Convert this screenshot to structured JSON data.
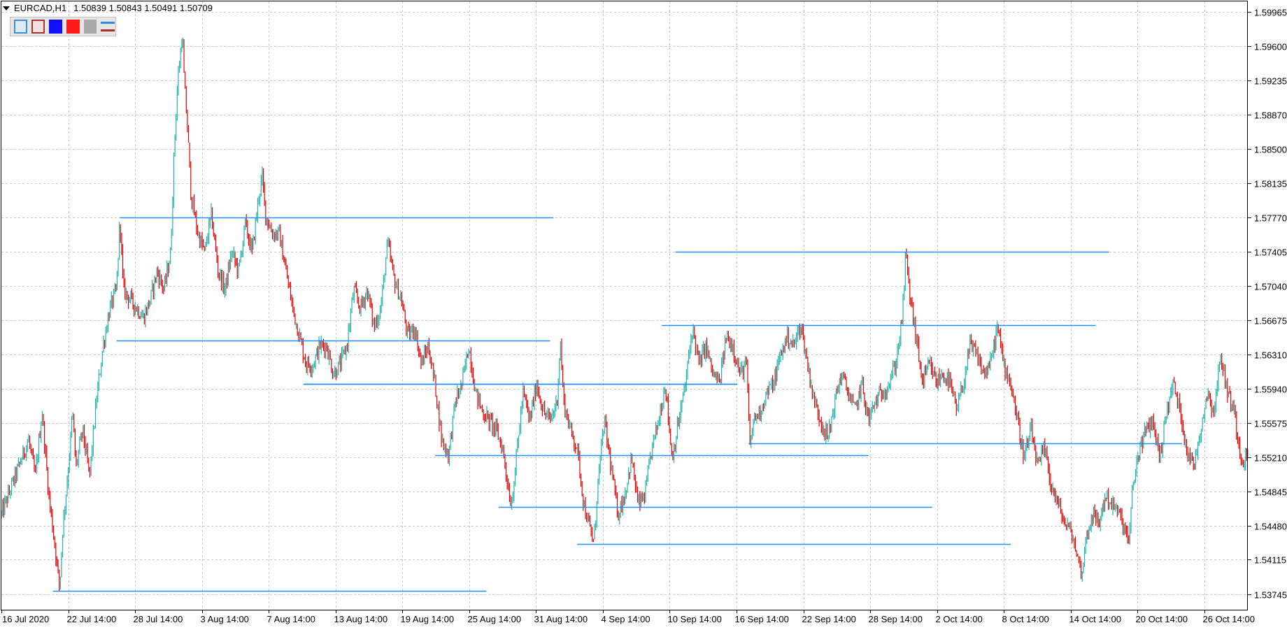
{
  "header": {
    "symbol": "EURCAD,H1",
    "ohlc": "1.50839 1.50843 1.50491 1.50709"
  },
  "toolbar": {
    "buttons": [
      "line-up-icon",
      "line-down-icon",
      "blue-color-icon",
      "red-color-icon",
      "gray-color-icon",
      "levels-icon"
    ]
  },
  "colors": {
    "background": "#ffffff",
    "grid": "#c8c8c8",
    "bull": "#20b2aa",
    "bear": "#e00000",
    "level": "#1e90ff"
  },
  "chart_data": {
    "type": "candlestick",
    "symbol": "EURCAD",
    "timeframe": "H1",
    "grid": true,
    "x_tick_labels": [
      "16 Jul 2020",
      "22 Jul 14:00",
      "28 Jul 14:00",
      "3 Aug 14:00",
      "7 Aug 14:00",
      "13 Aug 14:00",
      "19 Aug 14:00",
      "25 Aug 14:00",
      "31 Aug 14:00",
      "4 Sep 14:00",
      "10 Sep 14:00",
      "16 Sep 14:00",
      "22 Sep 14:00",
      "28 Sep 14:00",
      "2 Oct 14:00",
      "8 Oct 14:00",
      "14 Oct 14:00",
      "20 Oct 14:00",
      "26 Oct 14:00"
    ],
    "y_tick_labels": [
      "1.59965",
      "1.59600",
      "1.59235",
      "1.58870",
      "1.58500",
      "1.58135",
      "1.57770",
      "1.57405",
      "1.57040",
      "1.56675",
      "1.56310",
      "1.55940",
      "1.55575",
      "1.55210",
      "1.54845",
      "1.54480",
      "1.54115",
      "1.53745"
    ],
    "ylim": [
      1.5358,
      1.6008
    ],
    "price_path": [
      [
        0,
        1.546
      ],
      [
        2,
        1.55
      ],
      [
        4,
        1.554
      ],
      [
        5,
        1.55
      ],
      [
        6,
        1.557
      ],
      [
        7,
        1.548
      ],
      [
        8,
        1.542
      ],
      [
        8.6,
        1.538
      ],
      [
        9,
        1.544
      ],
      [
        10,
        1.552
      ],
      [
        10.5,
        1.557
      ],
      [
        11,
        1.551
      ],
      [
        12,
        1.555
      ],
      [
        13,
        1.55
      ],
      [
        14,
        1.558
      ],
      [
        15,
        1.564
      ],
      [
        16,
        1.568
      ],
      [
        17,
        1.57
      ],
      [
        17.5,
        1.5777
      ],
      [
        18,
        1.57
      ],
      [
        19,
        1.569
      ],
      [
        20,
        1.568
      ],
      [
        21,
        1.567
      ],
      [
        22,
        1.569
      ],
      [
        23,
        1.572
      ],
      [
        24,
        1.57
      ],
      [
        25,
        1.574
      ],
      [
        25.5,
        1.585
      ],
      [
        26,
        1.592
      ],
      [
        26.7,
        1.5975
      ],
      [
        27,
        1.592
      ],
      [
        27.5,
        1.587
      ],
      [
        28,
        1.58
      ],
      [
        29,
        1.576
      ],
      [
        30,
        1.574
      ],
      [
        31,
        1.578
      ],
      [
        32,
        1.572
      ],
      [
        33,
        1.57
      ],
      [
        34,
        1.574
      ],
      [
        35,
        1.572
      ],
      [
        36,
        1.577
      ],
      [
        37,
        1.574
      ],
      [
        38,
        1.58
      ],
      [
        38.5,
        1.582
      ],
      [
        39,
        1.578
      ],
      [
        40,
        1.576
      ],
      [
        41,
        1.576
      ],
      [
        42,
        1.572
      ],
      [
        43,
        1.568
      ],
      [
        44,
        1.565
      ],
      [
        45,
        1.562
      ],
      [
        46,
        1.562
      ],
      [
        47,
        1.564
      ],
      [
        48,
        1.564
      ],
      [
        49,
        1.561
      ],
      [
        50,
        1.562
      ],
      [
        51,
        1.564
      ],
      [
        52,
        1.57
      ],
      [
        53,
        1.568
      ],
      [
        54,
        1.57
      ],
      [
        55,
        1.566
      ],
      [
        56,
        1.568
      ],
      [
        57,
        1.575
      ],
      [
        58,
        1.571
      ],
      [
        59,
        1.569
      ],
      [
        60,
        1.565
      ],
      [
        61,
        1.566
      ],
      [
        62,
        1.562
      ],
      [
        63,
        1.564
      ],
      [
        64,
        1.56
      ],
      [
        65,
        1.554
      ],
      [
        66,
        1.5523
      ],
      [
        67,
        1.558
      ],
      [
        68,
        1.56
      ],
      [
        69,
        1.564
      ],
      [
        70,
        1.559
      ],
      [
        71,
        1.557
      ],
      [
        72,
        1.556
      ],
      [
        73,
        1.555
      ],
      [
        74,
        1.553
      ],
      [
        75,
        1.548
      ],
      [
        75.3,
        1.5471
      ],
      [
        76,
        1.552
      ],
      [
        77,
        1.559
      ],
      [
        78,
        1.556
      ],
      [
        79,
        1.56
      ],
      [
        80,
        1.557
      ],
      [
        81,
        1.556
      ],
      [
        82,
        1.558
      ],
      [
        82.5,
        1.5645
      ],
      [
        83,
        1.558
      ],
      [
        84,
        1.555
      ],
      [
        85,
        1.553
      ],
      [
        86,
        1.547
      ],
      [
        87,
        1.544
      ],
      [
        87.5,
        1.543
      ],
      [
        88,
        1.549
      ],
      [
        89,
        1.556
      ],
      [
        90,
        1.551
      ],
      [
        91,
        1.546
      ],
      [
        92,
        1.548
      ],
      [
        93,
        1.552
      ],
      [
        94,
        1.547
      ],
      [
        95,
        1.548
      ],
      [
        96,
        1.553
      ],
      [
        97,
        1.556
      ],
      [
        98,
        1.56
      ],
      [
        99,
        1.552
      ],
      [
        100,
        1.556
      ],
      [
        101,
        1.56
      ],
      [
        102,
        1.566
      ],
      [
        103,
        1.562
      ],
      [
        104,
        1.564
      ],
      [
        105,
        1.561
      ],
      [
        106,
        1.56
      ],
      [
        107,
        1.565
      ],
      [
        108,
        1.564
      ],
      [
        109,
        1.561
      ],
      [
        110,
        1.562
      ],
      [
        110.5,
        1.553
      ],
      [
        111,
        1.556
      ],
      [
        112,
        1.557
      ],
      [
        113,
        1.559
      ],
      [
        114,
        1.56
      ],
      [
        115,
        1.563
      ],
      [
        116,
        1.565
      ],
      [
        117,
        1.564
      ],
      [
        118,
        1.5663
      ],
      [
        119,
        1.562
      ],
      [
        120,
        1.558
      ],
      [
        121,
        1.556
      ],
      [
        122,
        1.554
      ],
      [
        123,
        1.558
      ],
      [
        124,
        1.561
      ],
      [
        125,
        1.559
      ],
      [
        126,
        1.557
      ],
      [
        127,
        1.56
      ],
      [
        128,
        1.556
      ],
      [
        129,
        1.558
      ],
      [
        130,
        1.559
      ],
      [
        131,
        1.56
      ],
      [
        132,
        1.562
      ],
      [
        133,
        1.567
      ],
      [
        133.5,
        1.574
      ],
      [
        134,
        1.57
      ],
      [
        135,
        1.565
      ],
      [
        136,
        1.56
      ],
      [
        137,
        1.562
      ],
      [
        138,
        1.56
      ],
      [
        139,
        1.561
      ],
      [
        140,
        1.56
      ],
      [
        141,
        1.557
      ],
      [
        142,
        1.56
      ],
      [
        143,
        1.564
      ],
      [
        144,
        1.563
      ],
      [
        145,
        1.561
      ],
      [
        146,
        1.562
      ],
      [
        147,
        1.566
      ],
      [
        148,
        1.562
      ],
      [
        149,
        1.56
      ],
      [
        150,
        1.556
      ],
      [
        151,
        1.552
      ],
      [
        152,
        1.555
      ],
      [
        153,
        1.551
      ],
      [
        154,
        1.553
      ],
      [
        155,
        1.549
      ],
      [
        156,
        1.547
      ],
      [
        157,
        1.545
      ],
      [
        158,
        1.544
      ],
      [
        159,
        1.541
      ],
      [
        159.5,
        1.5395
      ],
      [
        160,
        1.543
      ],
      [
        161,
        1.546
      ],
      [
        162,
        1.545
      ],
      [
        163,
        1.548
      ],
      [
        164,
        1.547
      ],
      [
        165,
        1.546
      ],
      [
        166,
        1.544
      ],
      [
        166.5,
        1.543
      ],
      [
        167,
        1.549
      ],
      [
        168,
        1.553
      ],
      [
        169,
        1.555
      ],
      [
        170,
        1.556
      ],
      [
        171,
        1.552
      ],
      [
        172,
        1.557
      ],
      [
        173,
        1.56
      ],
      [
        174,
        1.557
      ],
      [
        175,
        1.553
      ],
      [
        176,
        1.551
      ],
      [
        177,
        1.555
      ],
      [
        178,
        1.559
      ],
      [
        179,
        1.557
      ],
      [
        180,
        1.563
      ],
      [
        181,
        1.559
      ],
      [
        182,
        1.557
      ],
      [
        183,
        1.552
      ],
      [
        184,
        1.5521
      ]
    ],
    "levels": [
      {
        "price": 1.5777,
        "x_from": 17.5,
        "x_to": 81.5
      },
      {
        "price": 1.57405,
        "x_from": 99.5,
        "x_to": 163.5
      },
      {
        "price": 1.5662,
        "x_from": 97.5,
        "x_to": 161.5
      },
      {
        "price": 1.5646,
        "x_from": 17,
        "x_to": 81
      },
      {
        "price": 1.5599,
        "x_from": 44.6,
        "x_to": 108.6
      },
      {
        "price": 1.5599,
        "x_from": 44.6,
        "x_to": 108.6
      },
      {
        "price": 1.5536,
        "x_from": 110.3,
        "x_to": 174.3
      },
      {
        "price": 1.5523,
        "x_from": 64,
        "x_to": 128
      },
      {
        "price": 1.5468,
        "x_from": 73.4,
        "x_to": 137.4
      },
      {
        "price": 1.5428,
        "x_from": 85,
        "x_to": 149
      },
      {
        "price": 1.5378,
        "x_from": 7.6,
        "x_to": 71.6
      }
    ]
  }
}
